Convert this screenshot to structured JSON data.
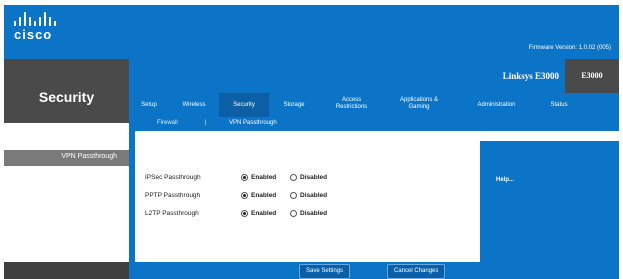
{
  "header": {
    "logo": "cisco",
    "firmware_label": "Firmware Version: 1.0.02 (005)"
  },
  "section": {
    "title": "Security"
  },
  "topbar": {
    "product": "Linksys E3000",
    "model": "E3000"
  },
  "tabs": [
    {
      "label": "Setup"
    },
    {
      "label": "Wireless"
    },
    {
      "label": "Security"
    },
    {
      "label": "Storage"
    },
    {
      "label": "Access\nRestrictions"
    },
    {
      "label": "Applications &\nGaming"
    },
    {
      "label": "Administration"
    },
    {
      "label": "Status"
    }
  ],
  "subtabs": {
    "firewall": "Firewall",
    "separator": "|",
    "vpn": "VPN Passthrough"
  },
  "left": {
    "vpn_label": "VPN Passthrough"
  },
  "rows": [
    {
      "label": "IPSec Passthrough",
      "enabled": "Enabled",
      "disabled": "Disabled",
      "selected": "enabled"
    },
    {
      "label": "PPTP Passthrough",
      "enabled": "Enabled",
      "disabled": "Disabled",
      "selected": "enabled"
    },
    {
      "label": "L2TP Passthrough",
      "enabled": "Enabled",
      "disabled": "Disabled",
      "selected": "enabled"
    }
  ],
  "help": {
    "link": "Help..."
  },
  "buttons": {
    "save": "Save Settings",
    "cancel": "Cancel Changes"
  },
  "colors": {
    "accent": "#0b74c6",
    "dark": "#4a4a4a"
  }
}
